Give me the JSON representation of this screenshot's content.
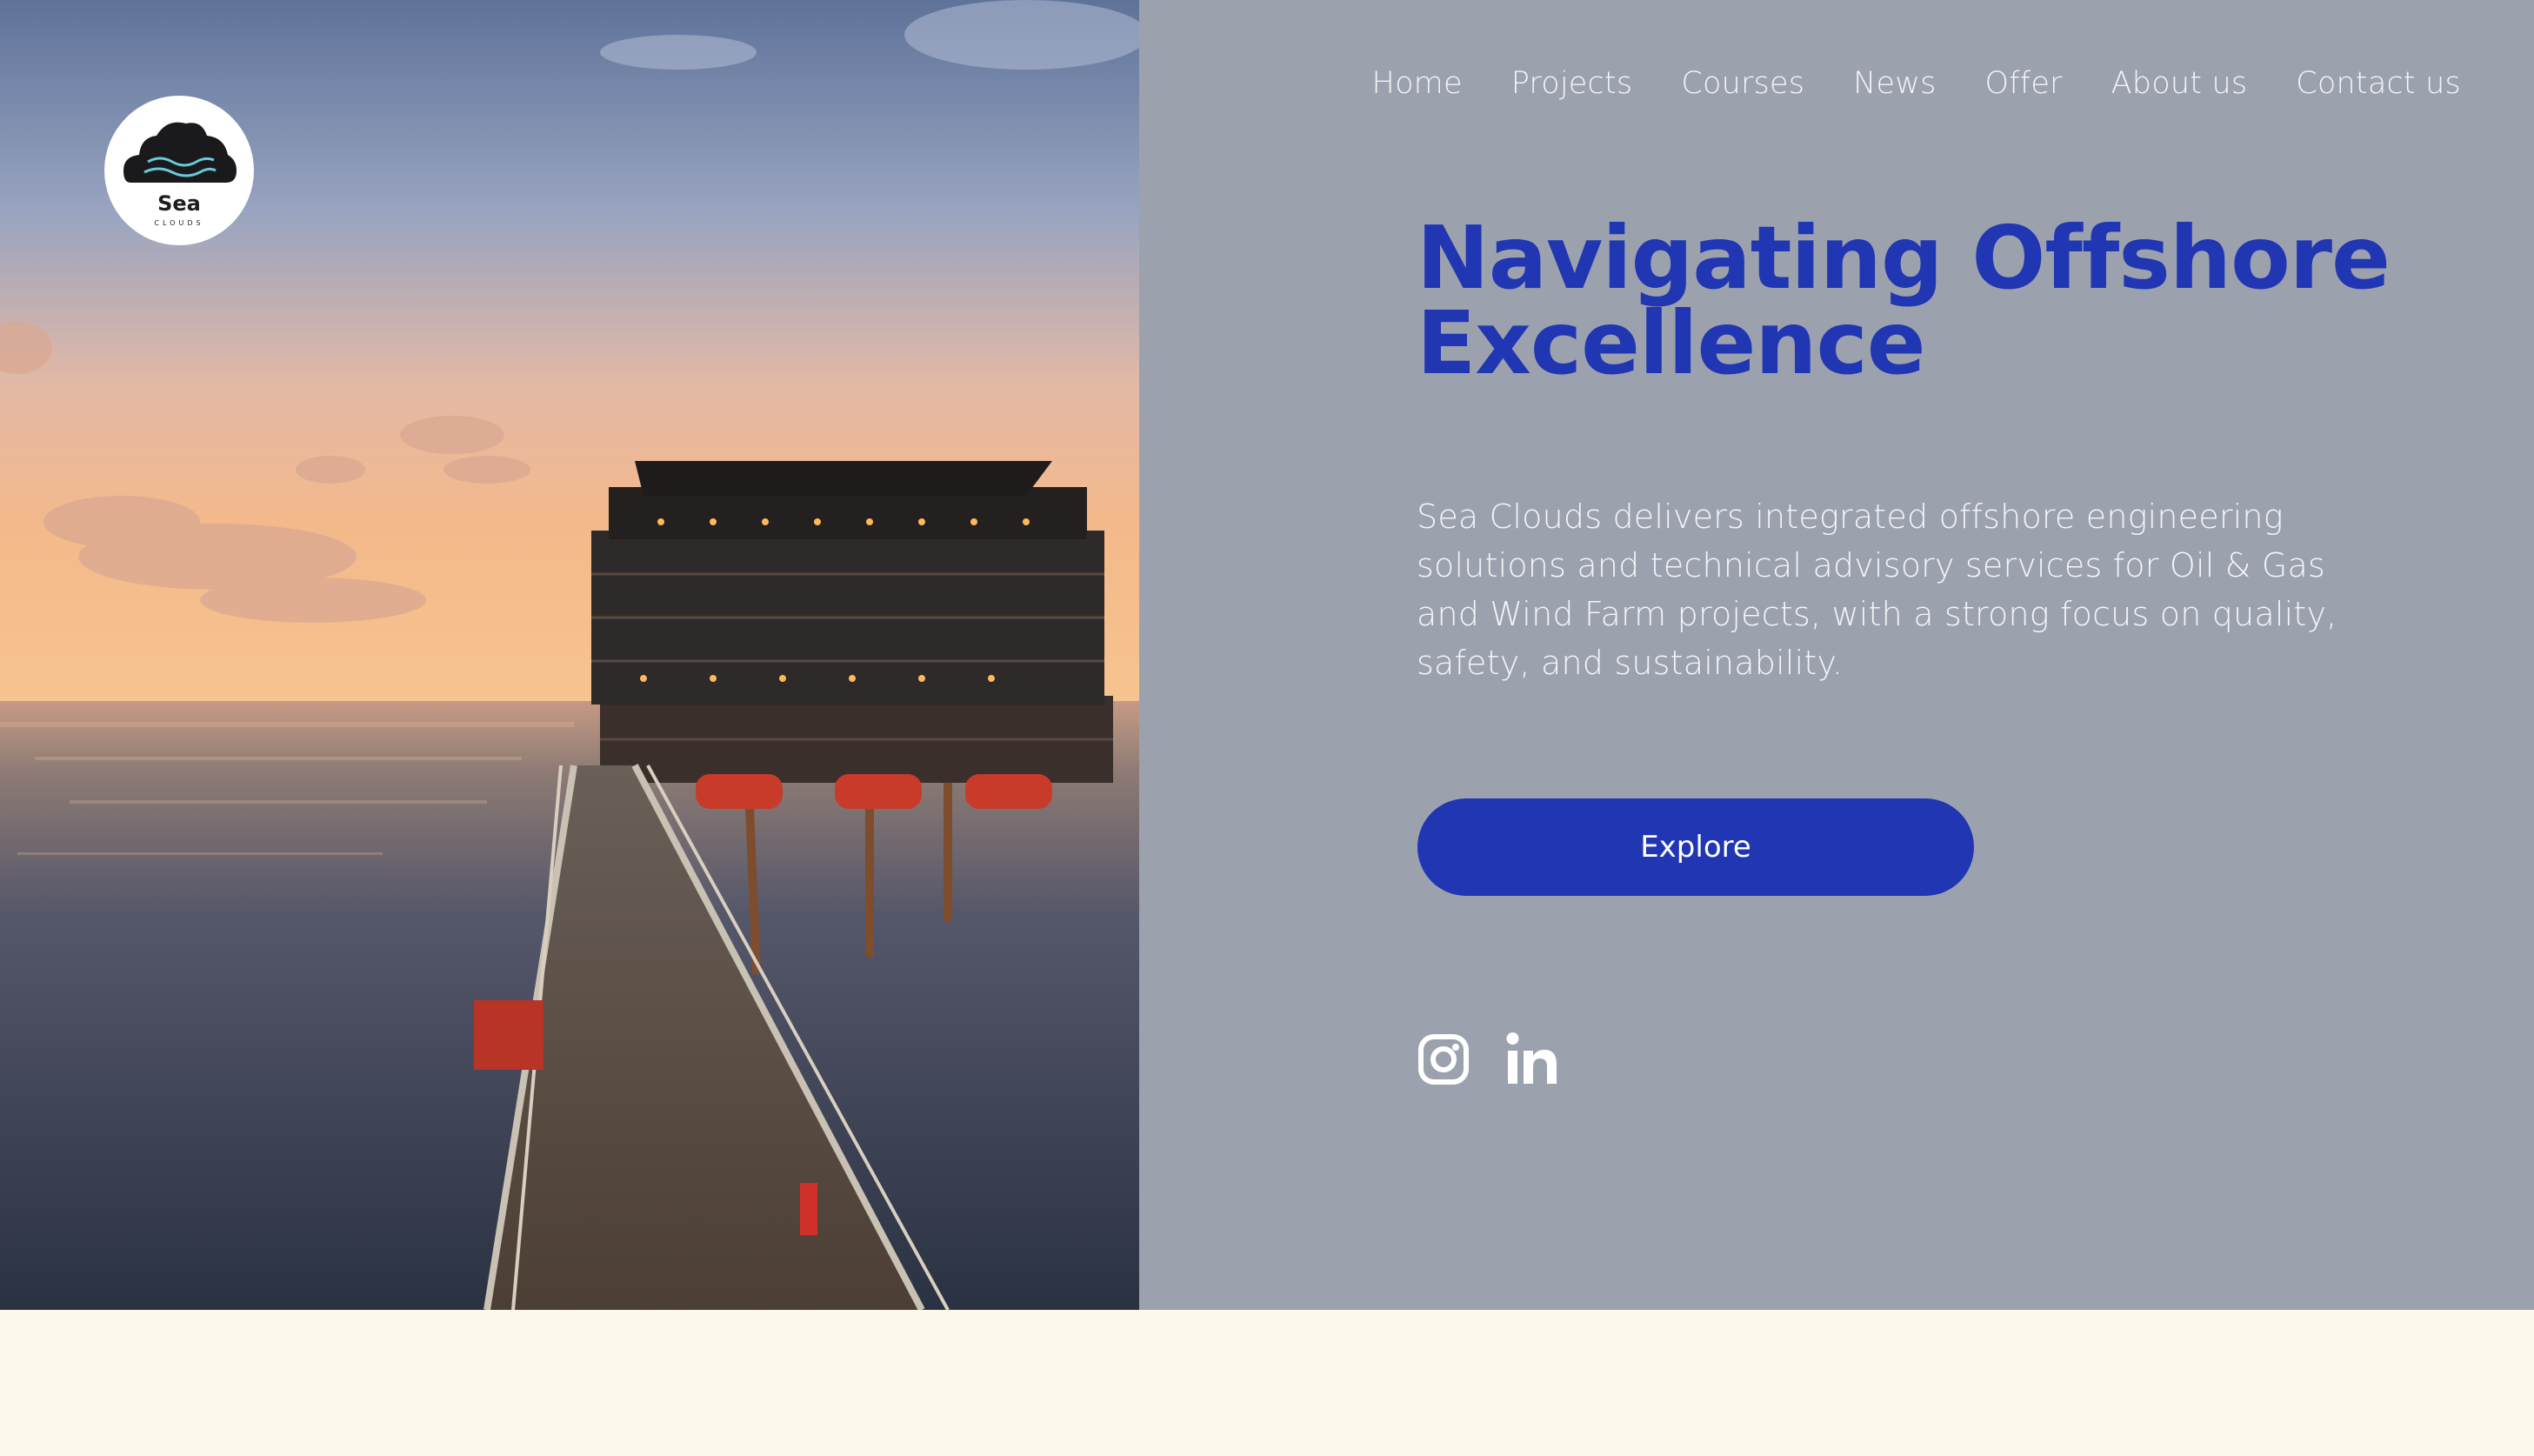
{
  "brand": {
    "name": "Sea",
    "sub": "CLOUDS"
  },
  "nav": [
    {
      "label": "Home"
    },
    {
      "label": "Projects"
    },
    {
      "label": "Courses"
    },
    {
      "label": "News"
    },
    {
      "label": "Offer"
    },
    {
      "label": "About us"
    },
    {
      "label": "Contact us"
    }
  ],
  "hero": {
    "title": "Navigating Offshore Excellence",
    "description": "Sea Clouds delivers integrated offshore engineering solutions and technical advisory services for Oil & Gas and Wind Farm projects, with a strong focus on quality, safety, and sustainability.",
    "cta_label": "Explore"
  },
  "social": [
    {
      "icon": "instagram-icon"
    },
    {
      "icon": "linkedin-icon"
    }
  ],
  "colors": {
    "accent": "#2036b2",
    "panel_bg": "#9ca1ae",
    "page_bg": "#fcf9ec",
    "nav_text": "#f4f5f8"
  }
}
